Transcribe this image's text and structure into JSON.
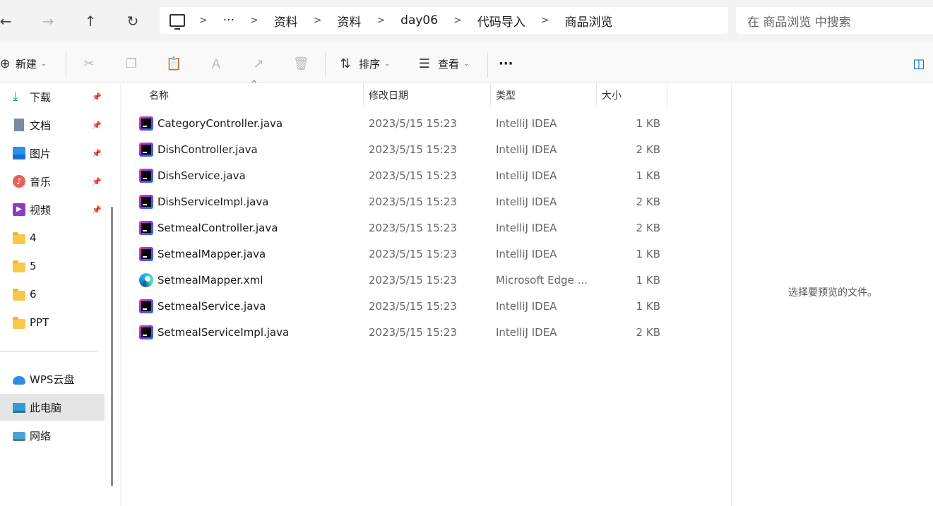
{
  "toolbar": {
    "back_icon": "←",
    "forward_icon": "→",
    "up_icon": "↑",
    "refresh_icon": "↻"
  },
  "breadcrumb": {
    "more": "···",
    "items": [
      "资料",
      "资料",
      "day06",
      "代码导入",
      "商品浏览"
    ]
  },
  "search": {
    "placeholder": "在 商品浏览 中搜索"
  },
  "commands": {
    "new_label": "新建",
    "sort_label": "排序",
    "view_label": "查看",
    "more_label": "···"
  },
  "sidebar": {
    "quick_access": [
      {
        "label": "下载",
        "icon": "download-icon"
      },
      {
        "label": "文档",
        "icon": "document-icon"
      },
      {
        "label": "图片",
        "icon": "picture-icon"
      },
      {
        "label": "音乐",
        "icon": "music-icon"
      },
      {
        "label": "视频",
        "icon": "video-icon"
      },
      {
        "label": "4",
        "icon": "folder-icon"
      },
      {
        "label": "5",
        "icon": "folder-icon"
      },
      {
        "label": "6",
        "icon": "folder-icon"
      },
      {
        "label": "PPT",
        "icon": "folder-icon"
      }
    ],
    "locations": [
      {
        "label": "WPS云盘",
        "icon": "cloud-icon"
      },
      {
        "label": "此电脑",
        "icon": "pc-icon"
      },
      {
        "label": "网络",
        "icon": "network-icon"
      }
    ]
  },
  "columns": {
    "name": "名称",
    "date": "修改日期",
    "type": "类型",
    "size": "大小"
  },
  "files": [
    {
      "name": "CategoryController.java",
      "date": "2023/5/15 15:23",
      "type": "IntelliJ IDEA",
      "size": "1 KB",
      "icon": "intellij-icon"
    },
    {
      "name": "DishController.java",
      "date": "2023/5/15 15:23",
      "type": "IntelliJ IDEA",
      "size": "2 KB",
      "icon": "intellij-icon"
    },
    {
      "name": "DishService.java",
      "date": "2023/5/15 15:23",
      "type": "IntelliJ IDEA",
      "size": "1 KB",
      "icon": "intellij-icon"
    },
    {
      "name": "DishServiceImpl.java",
      "date": "2023/5/15 15:23",
      "type": "IntelliJ IDEA",
      "size": "2 KB",
      "icon": "intellij-icon"
    },
    {
      "name": "SetmealController.java",
      "date": "2023/5/15 15:23",
      "type": "IntelliJ IDEA",
      "size": "2 KB",
      "icon": "intellij-icon"
    },
    {
      "name": "SetmealMapper.java",
      "date": "2023/5/15 15:23",
      "type": "IntelliJ IDEA",
      "size": "1 KB",
      "icon": "intellij-icon"
    },
    {
      "name": "SetmealMapper.xml",
      "date": "2023/5/15 15:23",
      "type": "Microsoft Edge ...",
      "size": "1 KB",
      "icon": "edge-icon"
    },
    {
      "name": "SetmealService.java",
      "date": "2023/5/15 15:23",
      "type": "IntelliJ IDEA",
      "size": "1 KB",
      "icon": "intellij-icon"
    },
    {
      "name": "SetmealServiceImpl.java",
      "date": "2023/5/15 15:23",
      "type": "IntelliJ IDEA",
      "size": "2 KB",
      "icon": "intellij-icon"
    }
  ],
  "preview": {
    "message": "选择要预览的文件。"
  },
  "colors": {
    "selected_bg": "#e5e5e5",
    "accent": "#0067c0"
  }
}
